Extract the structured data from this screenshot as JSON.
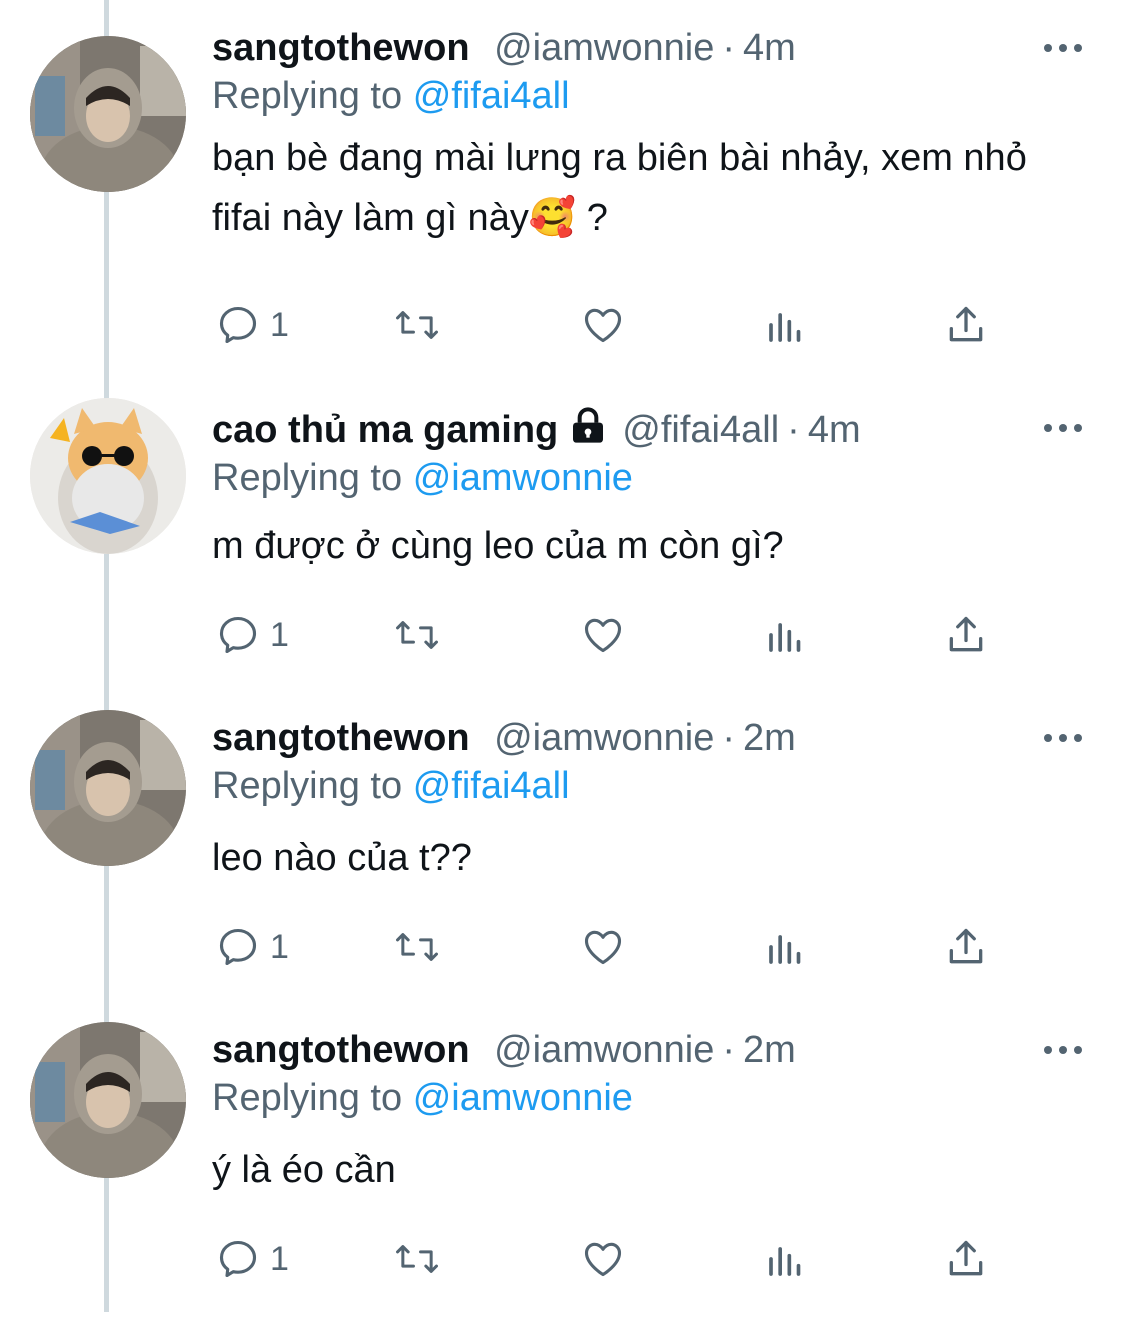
{
  "tweets": [
    {
      "display_name": "sangtothewon",
      "handle": "@iamwonnie",
      "dot": "·",
      "time": "4m",
      "locked": false,
      "avatar": "avatar-hoodie-boy",
      "replying_prefix": "Replying to",
      "replying_to": "@fifai4all",
      "text": "bạn bè đang mài lưng ra biên bài nhảy, xem nhỏ fifai này làm gì này🥰 ?",
      "reply_count": "1"
    },
    {
      "display_name": "cao thủ ma gaming",
      "handle": "@fifai4all",
      "dot": "·",
      "time": "4m",
      "locked": true,
      "avatar": "avatar-cat-sunglasses",
      "replying_prefix": "Replying to",
      "replying_to": "@iamwonnie",
      "text": "m được ở cùng leo của m còn gì?",
      "reply_count": "1"
    },
    {
      "display_name": "sangtothewon",
      "handle": "@iamwonnie",
      "dot": "·",
      "time": "2m",
      "locked": false,
      "avatar": "avatar-hoodie-boy",
      "replying_prefix": "Replying to",
      "replying_to": "@fifai4all",
      "text": "leo nào của t??",
      "reply_count": "1"
    },
    {
      "display_name": "sangtothewon",
      "handle": "@iamwonnie",
      "dot": "·",
      "time": "2m",
      "locked": false,
      "avatar": "avatar-hoodie-boy",
      "replying_prefix": "Replying to",
      "replying_to": "@iamwonnie",
      "text": "ý là éo cần",
      "reply_count": "1"
    }
  ],
  "icons": {
    "reply": "reply-icon",
    "retweet": "retweet-icon",
    "like": "heart-icon",
    "views": "analytics-icon",
    "share": "share-icon",
    "more": "more-icon",
    "lock": "lock-icon"
  },
  "colors": {
    "text": "#0f1419",
    "secondary": "#536471",
    "mention": "#1d9bf0",
    "thread_line": "#cfd9de"
  }
}
